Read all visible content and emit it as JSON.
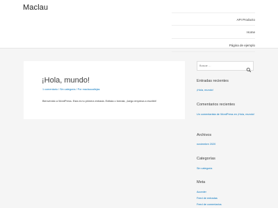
{
  "site": {
    "title": "Maclau"
  },
  "nav": {
    "items": [
      {
        "label": "API Producto"
      },
      {
        "label": "Home"
      },
      {
        "label": "Página de ejemplo"
      }
    ]
  },
  "post": {
    "title": "¡Hola, mundo!",
    "meta": {
      "comments": "1 comentario",
      "separator1": " / ",
      "category": "Sin categoría",
      "separator2": " / Por ",
      "author": "maclaucallejas"
    },
    "excerpt": "Bienvenido a WordPress. Esta es tu primera entrada. Edítala o bórrala, ¡luego empieza a escribir!"
  },
  "sidebar": {
    "search": {
      "placeholder": "Buscar …"
    },
    "recent_posts": {
      "title": "Entradas recientes",
      "items": [
        "¡Hola, mundo!"
      ]
    },
    "recent_comments": {
      "title": "Comentarios recientes",
      "item": "Un comentarista de WordPress en ¡Hola, mundo!"
    },
    "archives": {
      "title": "Archivos",
      "items": [
        "noviembre 2020"
      ]
    },
    "categories": {
      "title": "Categorías",
      "items": [
        "Sin categoría"
      ]
    },
    "meta": {
      "title": "Meta",
      "items": [
        "Acceder",
        "Feed de entradas",
        "Feed de comentarios"
      ]
    }
  },
  "colors": {
    "link": "#0274be",
    "text": "#3a3a3a",
    "background": "#f5f5f5"
  }
}
